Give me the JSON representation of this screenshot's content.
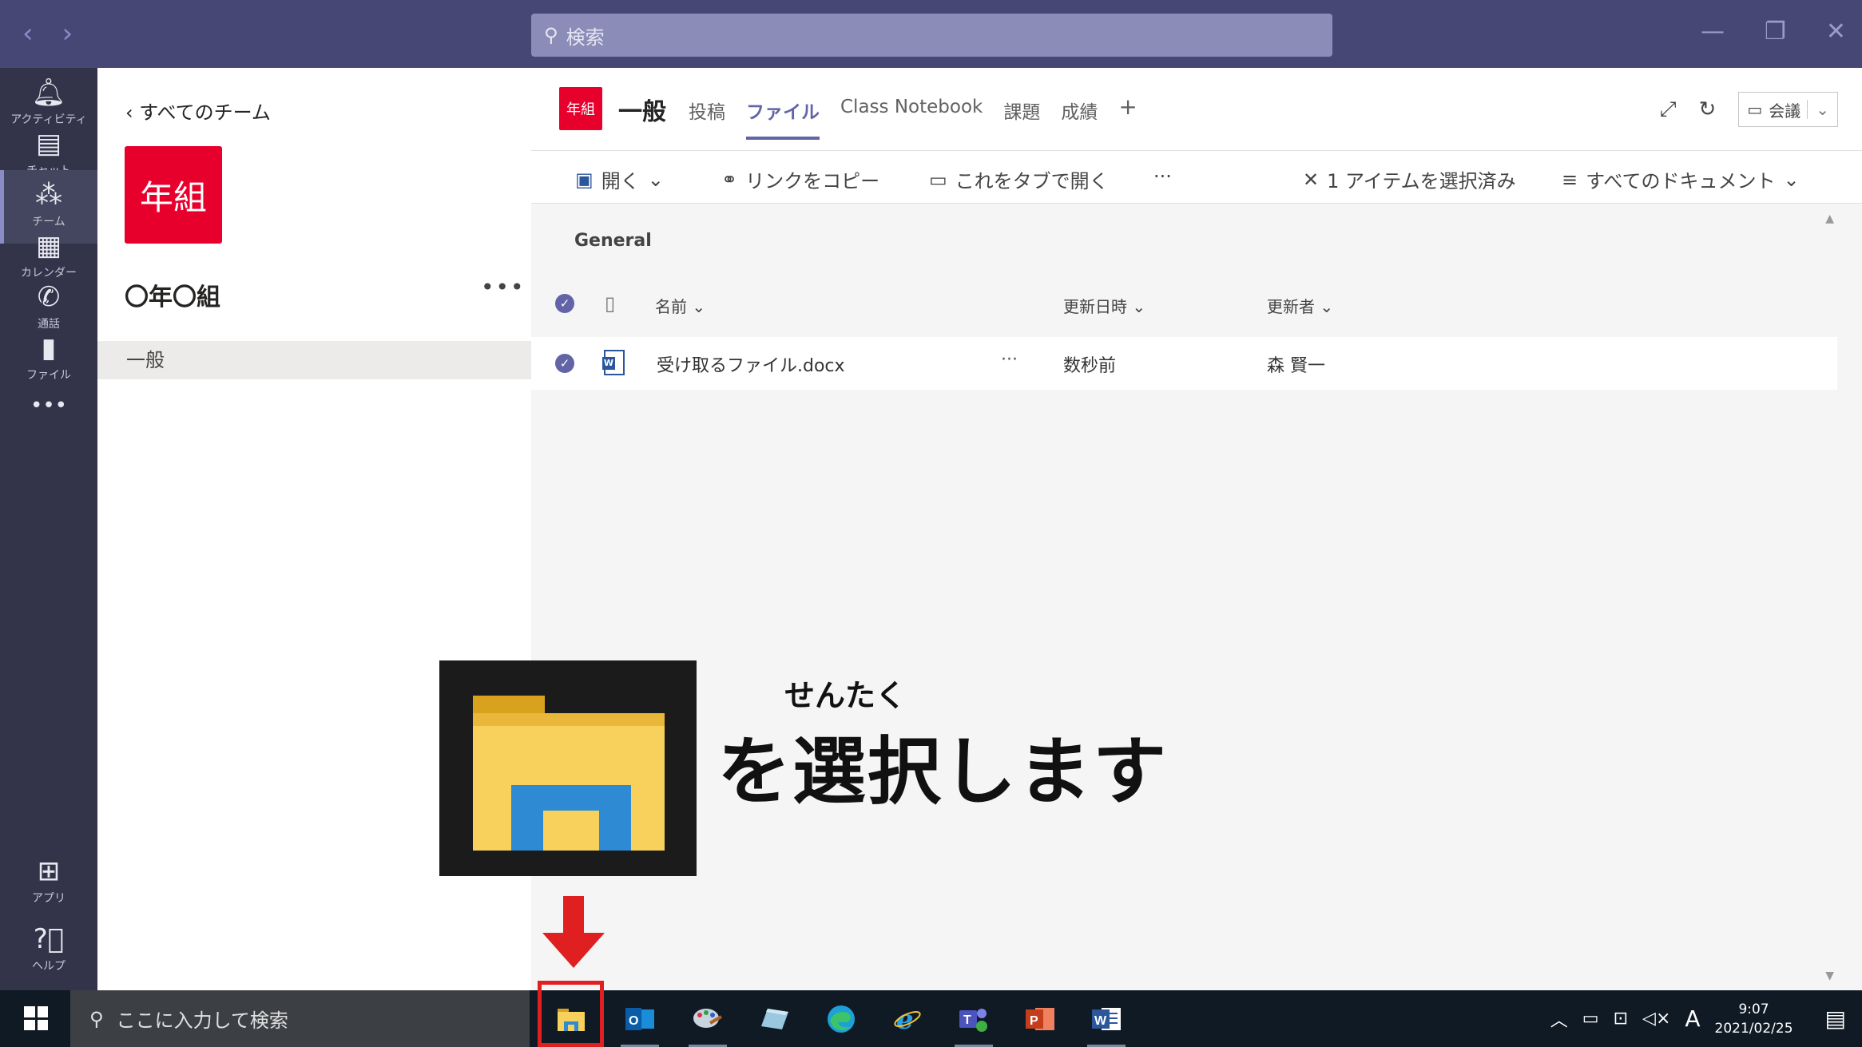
{
  "titlebar": {
    "search_placeholder": "検索"
  },
  "rail": {
    "items": [
      {
        "label": "アクティビティ"
      },
      {
        "label": "チャット"
      },
      {
        "label": "チーム"
      },
      {
        "label": "カレンダー"
      },
      {
        "label": "通話"
      },
      {
        "label": "ファイル"
      },
      {
        "label": "アプリ"
      },
      {
        "label": "ヘルプ"
      }
    ],
    "more": "•••"
  },
  "team_panel": {
    "back_label": "すべてのチーム",
    "logo_text": "年組",
    "team_name": "〇年〇組",
    "more": "•••",
    "channel": "一般"
  },
  "header": {
    "channel_logo": "年組",
    "channel_title": "一般",
    "tabs": [
      "投稿",
      "ファイル",
      "Class Notebook",
      "課題",
      "成績"
    ],
    "add_tab": "+",
    "meeting_label": "会議"
  },
  "toolbar": {
    "open": "開く",
    "copy_link": "リンクをコピー",
    "open_tab": "これをタブで開く",
    "more": "···",
    "selected": "1 アイテムを選択済み",
    "all_docs": "すべてのドキュメント"
  },
  "files": {
    "section": "General",
    "columns": {
      "name": "名前",
      "modified": "更新日時",
      "modified_by": "更新者"
    },
    "rows": [
      {
        "name": "受け取るファイル.docx",
        "more": "···",
        "modified": "数秒前",
        "modified_by": "森 賢一"
      }
    ]
  },
  "overlay": {
    "ruby": "せんたく",
    "instruction": "を選択します"
  },
  "taskbar": {
    "search_placeholder": "ここに入力して検索",
    "ime": "A",
    "time": "9:07",
    "date": "2021/02/25"
  },
  "colors": {
    "titlebar": "#464775",
    "rail": "#33344a",
    "accent": "#6264a7",
    "team_logo": "#e8002d",
    "highlight": "#e02020"
  }
}
